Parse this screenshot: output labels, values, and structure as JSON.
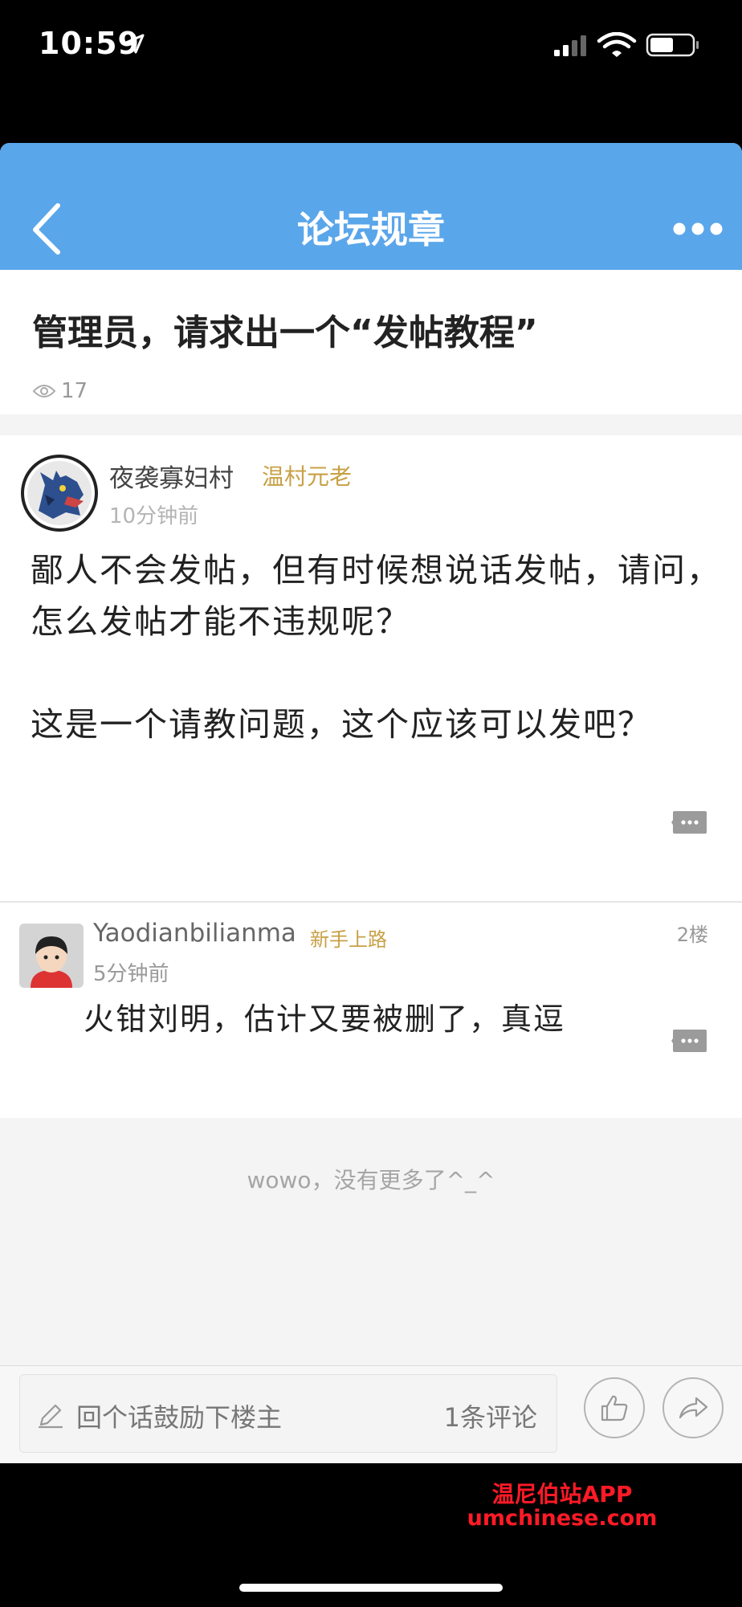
{
  "status_bar": {
    "time": "10:59"
  },
  "nav": {
    "title": "论坛规章"
  },
  "thread": {
    "title": "管理员，请求出一个“发帖教程”",
    "views": "17"
  },
  "post": {
    "author": "夜袭寡妇村",
    "badge": "温村元老",
    "time": "10分钟前",
    "paragraphs": [
      "鄙人不会发帖，但有时候想说话发帖，请问，怎么发帖才能不违规呢？",
      "这是一个请教问题，这个应该可以发吧？"
    ]
  },
  "reply": {
    "author": "Yaodianbilianma",
    "badge": "新手上路",
    "floor": "2楼",
    "time": "5分钟前",
    "content": "火钳刘明，估计又要被删了，真逗"
  },
  "footer": {
    "no_more": "wowo，没有更多了^_^"
  },
  "bottom_bar": {
    "placeholder": "回个话鼓励下楼主",
    "comment_count": "1条评论"
  },
  "watermark": {
    "line1": "温尼伯站APP",
    "line2": "umchinese.com"
  },
  "colors": {
    "nav_bg": "#5aa6ea",
    "badge": "#c8a045",
    "watermark": "#ff1a26"
  }
}
